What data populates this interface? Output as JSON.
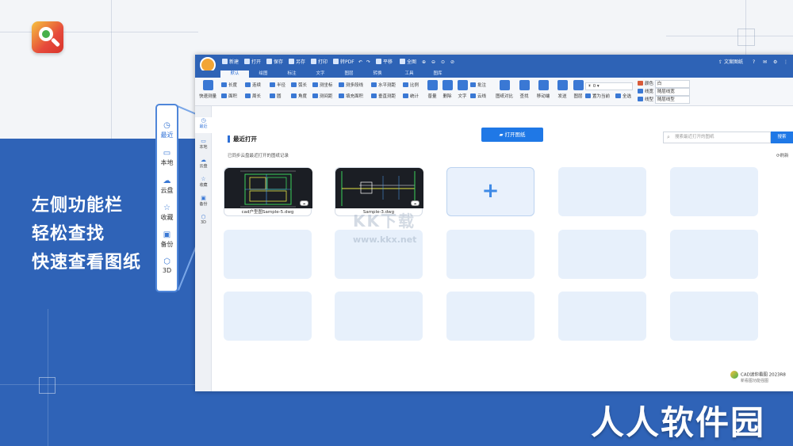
{
  "tagline": [
    "左侧功能栏",
    "轻松查找",
    "快速查看图纸"
  ],
  "brand": "人人软件园",
  "callout_sidebar": [
    {
      "icon": "clock-icon",
      "label": "最近",
      "active": true
    },
    {
      "icon": "monitor-icon",
      "label": "本地"
    },
    {
      "icon": "cloud-icon",
      "label": "云盘"
    },
    {
      "icon": "star-icon",
      "label": "收藏"
    },
    {
      "icon": "backup-icon",
      "label": "备份"
    },
    {
      "icon": "cube-icon",
      "label": "3D"
    }
  ],
  "quick_access": [
    {
      "label": "新建"
    },
    {
      "label": "打开"
    },
    {
      "label": "保存"
    },
    {
      "label": "另存"
    },
    {
      "label": "打印"
    },
    {
      "label": "转PDF"
    },
    {
      "label": "平移"
    },
    {
      "label": "全图"
    }
  ],
  "title_right": {
    "feedback": "文案图纸"
  },
  "tabs": [
    "默认",
    "绘图",
    "标注",
    "文字",
    "图层",
    "转换",
    "工具",
    "图库"
  ],
  "ribbon": {
    "measure_big": "快速测量",
    "row1": [
      "长度",
      "连续",
      "半径",
      "弧长",
      "测坐标",
      "测多段线",
      "水平测距",
      "比例"
    ],
    "row2": [
      "面积",
      "周长",
      "圆",
      "角度",
      "测间距",
      "填充面积",
      "垂直测距",
      "统计"
    ],
    "big_tools": [
      "普量",
      "删除",
      "文字",
      "批注",
      "云线",
      "图纸对比",
      "查找",
      "移动端",
      "发送",
      "图层",
      "置为当前",
      "全选"
    ],
    "layer_value": "0",
    "props": [
      {
        "label": "颜色",
        "value": "白"
      },
      {
        "label": "线宽",
        "value": "随层线宽"
      },
      {
        "label": "线型",
        "value": "随层线型"
      }
    ]
  },
  "sidebar": [
    {
      "icon": "clock-icon",
      "label": "最近",
      "active": true
    },
    {
      "icon": "monitor-icon",
      "label": "本地"
    },
    {
      "icon": "cloud-icon",
      "label": "云盘"
    },
    {
      "icon": "star-icon",
      "label": "收藏"
    },
    {
      "icon": "backup-icon",
      "label": "备份"
    },
    {
      "icon": "cube-icon",
      "label": "3D"
    }
  ],
  "main": {
    "section_title": "最近打开",
    "open_button": "打开图纸",
    "search_placeholder": "搜索最近打开的图纸",
    "search_button": "搜索",
    "synced_text": "已同步云盘最近打开的图纸记录",
    "refresh": "刷新"
  },
  "files": [
    {
      "name": "cad户型图Sample-5.dwg"
    },
    {
      "name": "Sample-3.dwg"
    }
  ],
  "watermark": {
    "text": "KK下载",
    "url": "www.kkx.net"
  },
  "version": {
    "name": "CAD迷你看图 2023R8",
    "sub": "新看图功能强图"
  },
  "colors": {
    "primary": "#2e63b6",
    "accent": "#1f78e6",
    "card": "#e7f0fb",
    "bg_blue": "#2f63b7"
  }
}
